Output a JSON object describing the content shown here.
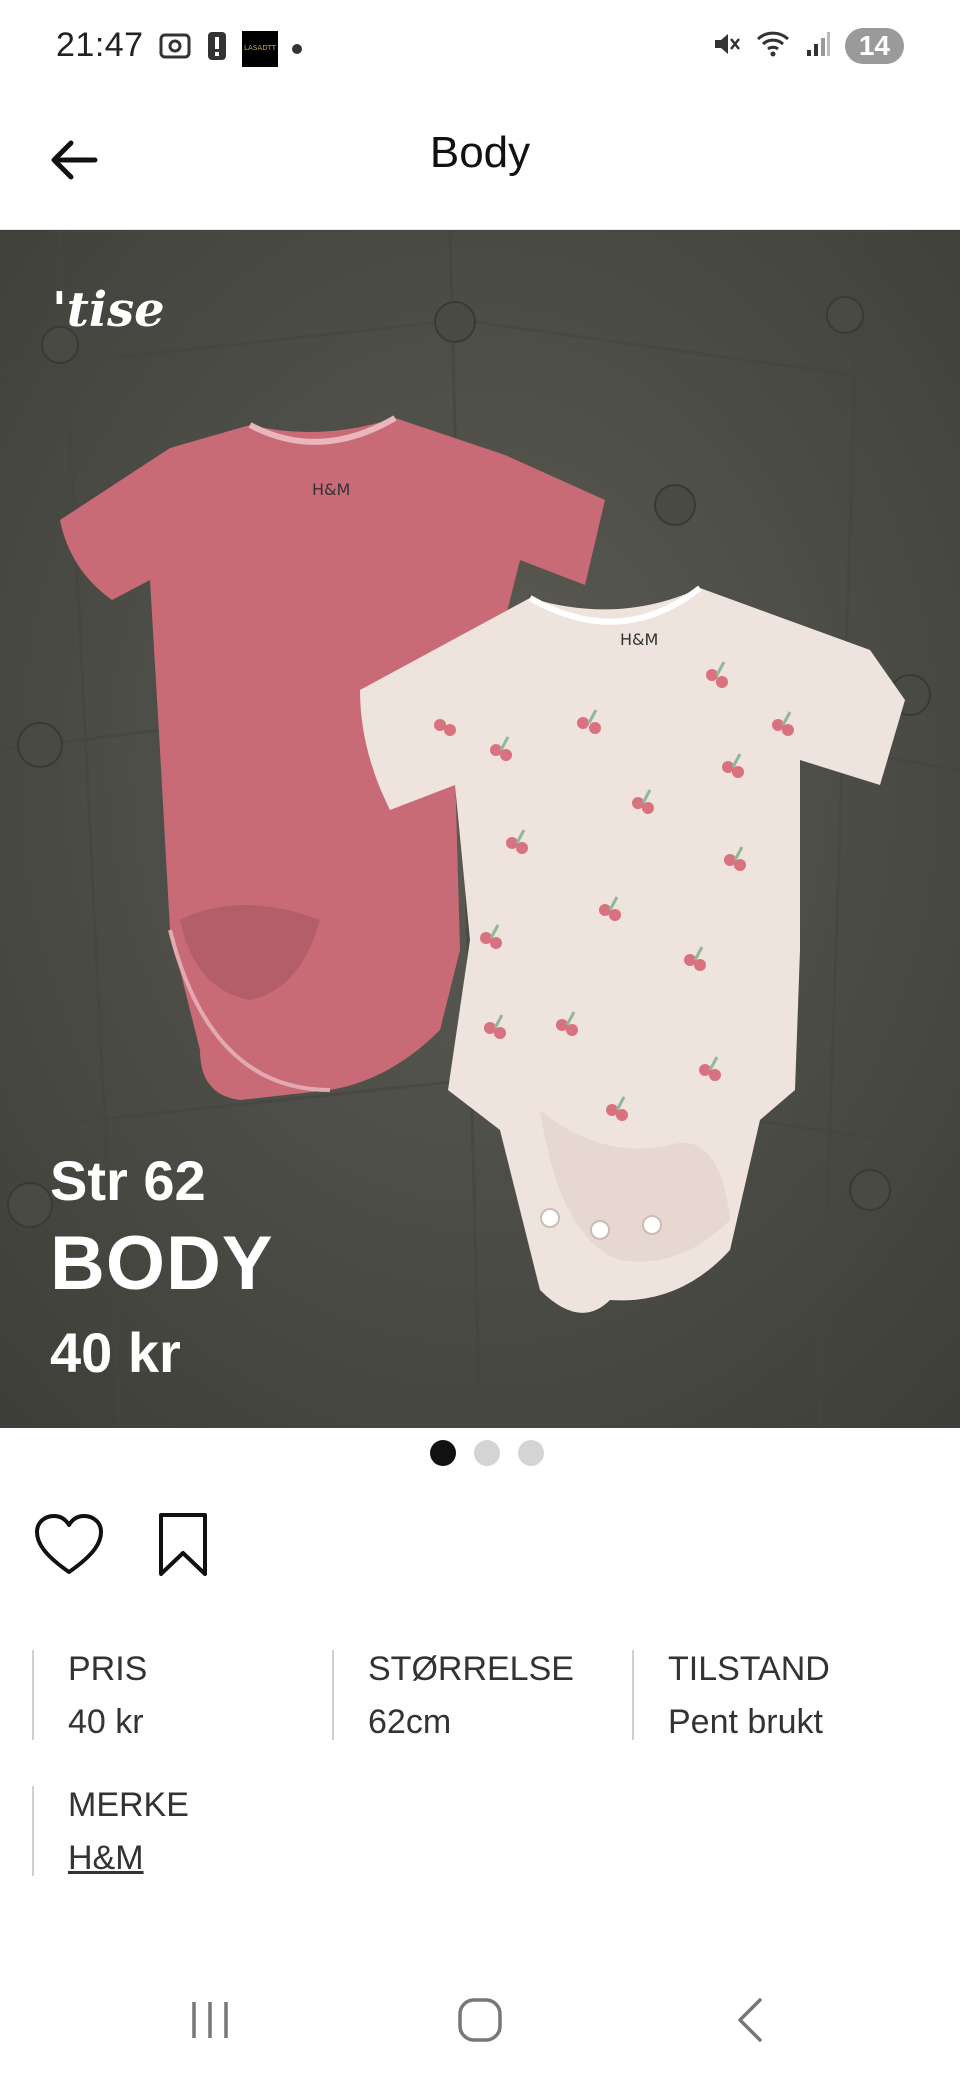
{
  "status_bar": {
    "time": "21:47",
    "left_icons": [
      "screenshot-icon",
      "alert-icon",
      "app-icon",
      "dot-icon"
    ],
    "right_icons": [
      "mute-icon",
      "wifi-icon",
      "signal-icon"
    ],
    "notification_count": "14"
  },
  "header": {
    "title": "Body",
    "back_icon": "arrow-left-icon"
  },
  "hero": {
    "brand": "'tise",
    "overlay_size": "Str 62",
    "overlay_name": "BODY",
    "overlay_price": "40 kr",
    "colors": {
      "background": "#515149",
      "pink_bodysuit": "#c96b76",
      "white_bodysuit": "#efe3de",
      "cherry": "#d9727f"
    }
  },
  "pager": {
    "count": 3,
    "active_index": 0
  },
  "actions": {
    "like_icon": "heart-icon",
    "save_icon": "bookmark-icon"
  },
  "attributes": [
    {
      "label": "PRIS",
      "value": "40 kr"
    },
    {
      "label": "STØRRELSE",
      "value": "62cm"
    },
    {
      "label": "TILSTAND",
      "value": "Pent brukt"
    },
    {
      "label": "MERKE",
      "value": "H&M"
    }
  ],
  "nav_bar": {
    "recents_icon": "recents-icon",
    "home_icon": "home-icon",
    "back_icon": "back-icon"
  }
}
